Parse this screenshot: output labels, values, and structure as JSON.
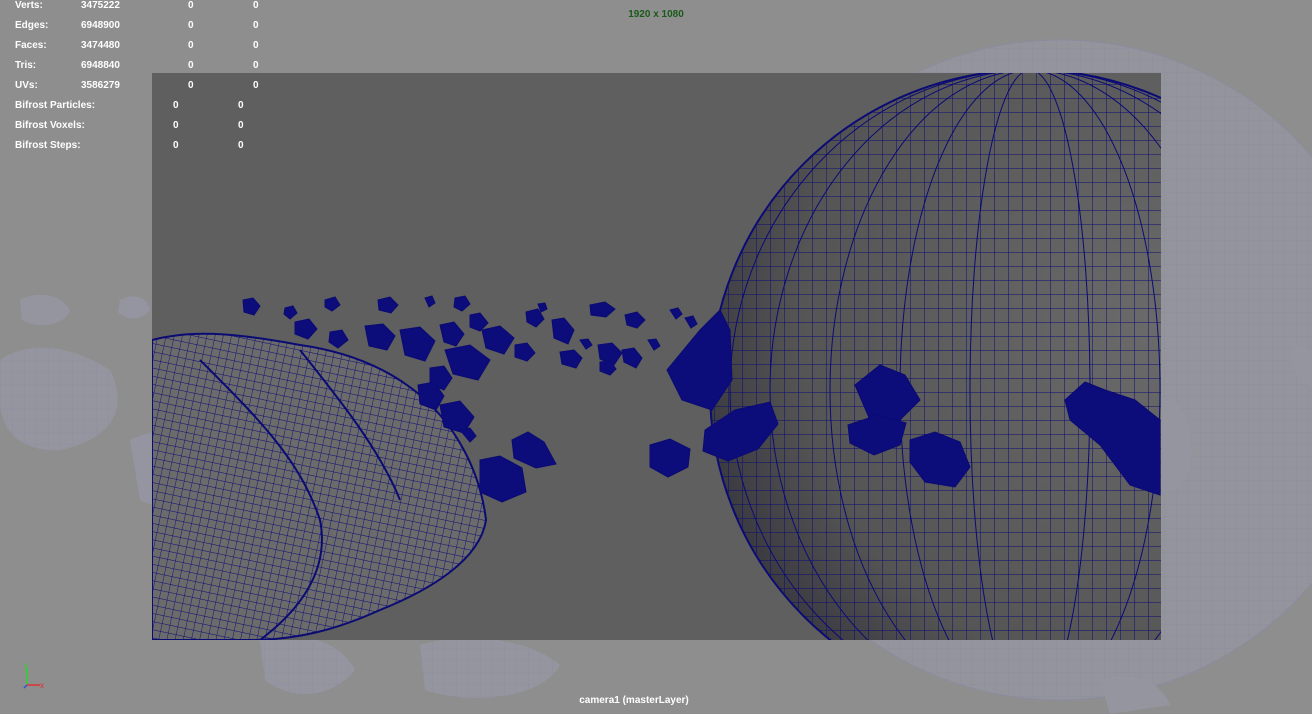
{
  "resolution_gate": "1920 x 1080",
  "camera_label": "camera1 (masterLayer)",
  "hud": {
    "rows": [
      {
        "label": "Verts:",
        "values": [
          "3475222",
          "0",
          "0"
        ]
      },
      {
        "label": "Edges:",
        "values": [
          "6948900",
          "0",
          "0"
        ]
      },
      {
        "label": "Faces:",
        "values": [
          "3474480",
          "0",
          "0"
        ]
      },
      {
        "label": "Tris:",
        "values": [
          "6948840",
          "0",
          "0"
        ]
      },
      {
        "label": "UVs:",
        "values": [
          "3586279",
          "0",
          "0"
        ]
      }
    ],
    "bifrost_rows": [
      {
        "label": "Bifrost Particles:",
        "values": [
          "0",
          "0"
        ]
      },
      {
        "label": "Bifrost Voxels:",
        "values": [
          "0",
          "0"
        ]
      },
      {
        "label": "Bifrost Steps:",
        "values": [
          "0",
          "0"
        ]
      }
    ]
  },
  "colors": {
    "viewport_bg": "#8e8e8e",
    "gate_bg": "#5f5f5f",
    "wireframe": "#0b0b74",
    "hud_text": "#ffffff",
    "resolution_text": "#1b5a1b",
    "axis_y": "#2fd02f",
    "axis_x": "#e03030"
  },
  "axis_indicator": {
    "x_label": "x",
    "y_label": "y"
  },
  "icons": [
    "axis-indicator-icon"
  ]
}
